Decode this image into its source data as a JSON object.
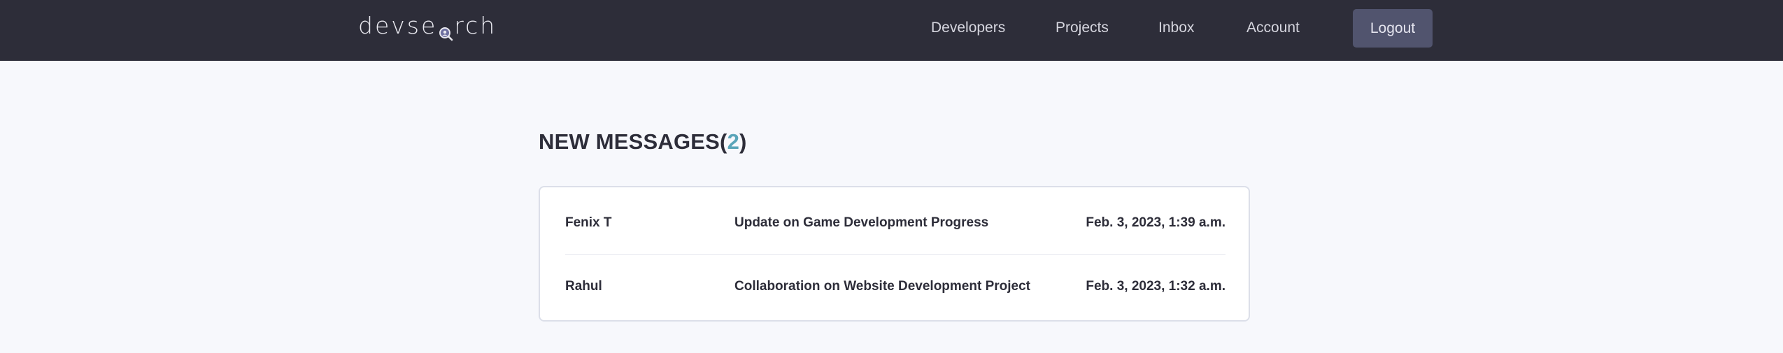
{
  "header": {
    "logo_left": "devse",
    "logo_right": "rch",
    "nav": [
      "Developers",
      "Projects",
      "Inbox",
      "Account"
    ],
    "logout_label": "Logout"
  },
  "inbox": {
    "heading": "NEW MESSAGES",
    "open_paren": "(",
    "count": "2",
    "close_paren": ")",
    "messages": [
      {
        "sender": "Fenix T",
        "subject": "Update on Game Development Progress",
        "date": "Feb. 3, 2023, 1:39 a.m."
      },
      {
        "sender": "Rahul",
        "subject": "Collaboration on Website Development Project",
        "date": "Feb. 3, 2023, 1:32 a.m."
      }
    ]
  },
  "colors": {
    "header_bg": "#2d2d39",
    "page_bg": "#f7f8fc",
    "accent": "#5aa5b9",
    "button_bg": "#51546e"
  },
  "icons": {
    "logo_lens": "magnifier-icon"
  }
}
